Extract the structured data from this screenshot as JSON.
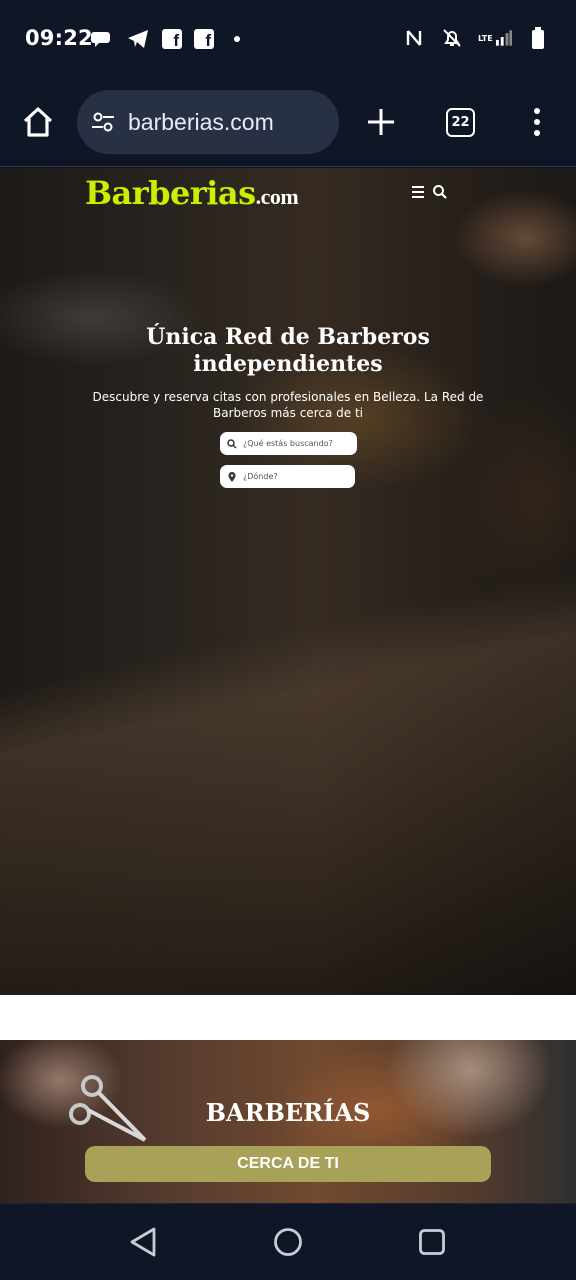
{
  "status_bar": {
    "time": "09:22",
    "left_icons": [
      "messages-icon",
      "telegram-icon",
      "facebook-icon",
      "facebook-icon",
      "dot-icon"
    ],
    "right_icons": [
      "nfc-icon",
      "mute-icon",
      "lte-signal-icon",
      "battery-icon"
    ],
    "facebook_letter": "f",
    "lte_label": "LTE"
  },
  "browser": {
    "url": "barberias.com",
    "tab_count": "22"
  },
  "site": {
    "logo_main": "Barberias",
    "logo_suffix": ".com",
    "hero_title_line1": "Única Red de Barberos",
    "hero_title_line2": "independientes",
    "hero_subtitle": "Descubre y reserva citas con profesionales en Belleza. La Red de Barberos más cerca de ti",
    "search_what_placeholder": "¿Qué estás buscando?",
    "search_where_placeholder": "¿Dónde?",
    "promo_title": "BARBERÍAS",
    "promo_button": "CERCA DE TI",
    "colors": {
      "logo": "#c8f000",
      "promo_button": "#a8a258",
      "chrome_bg": "#0f1626",
      "url_pill": "#283144"
    }
  }
}
